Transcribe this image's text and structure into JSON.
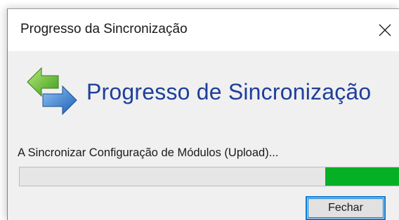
{
  "window": {
    "title": "Progresso da Sincronização"
  },
  "header": {
    "title": "Progresso de Sincronização",
    "icon": "sync-arrows-icon"
  },
  "status": {
    "text": "A Sincronizar Configuração de Módulos (Upload)..."
  },
  "progress": {
    "fill_start_fraction": 0.78,
    "fill_end_fraction": 1.0,
    "color": "#06b025",
    "track_color": "#e6e6e6"
  },
  "buttons": {
    "close_label": "Fechar"
  },
  "colors": {
    "title_blue": "#1e3f9a",
    "focus_blue": "#0078d7"
  }
}
